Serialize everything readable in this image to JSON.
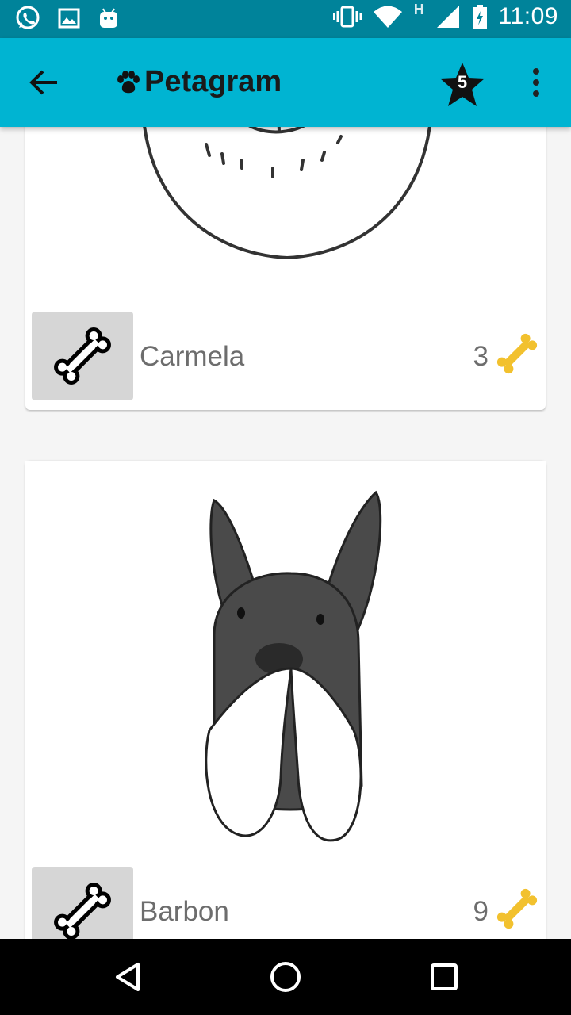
{
  "status_bar": {
    "time": "11:09",
    "network_type": "H",
    "icons": [
      "whatsapp-icon",
      "gallery-icon",
      "android-icon",
      "vibrate-icon",
      "wifi-icon",
      "signal-icon",
      "battery-charging-icon"
    ]
  },
  "app_bar": {
    "title": "Petagram",
    "favorites_count": "5",
    "icons": [
      "back-arrow-icon",
      "paw-icon",
      "star-icon",
      "more-vert-icon"
    ]
  },
  "pets": [
    {
      "name": "Carmela",
      "likes": "3"
    },
    {
      "name": "Barbon",
      "likes": "9"
    }
  ],
  "colors": {
    "status_bar": "#00839a",
    "app_bar": "#00b4d2",
    "like_button_bg": "#d6d6d6",
    "gold_bone": "#f2c12e",
    "text_secondary": "#6d6d6d"
  },
  "nav_bar": {
    "icons": [
      "back-triangle-icon",
      "home-circle-icon",
      "recents-square-icon"
    ]
  }
}
